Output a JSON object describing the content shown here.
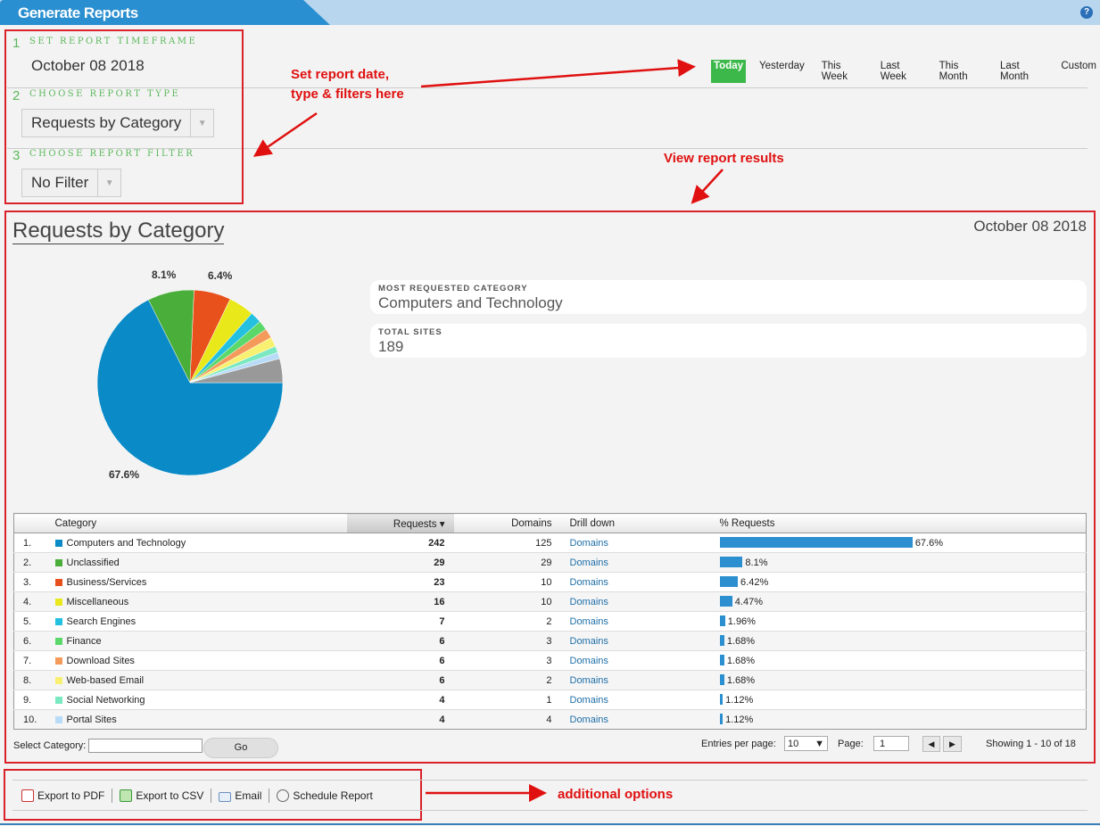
{
  "header": {
    "title": "Generate Reports",
    "help_icon": "help-icon"
  },
  "steps": [
    {
      "num": "1",
      "label": "SET REPORT TIMEFRAME",
      "value": "October 08 2018"
    },
    {
      "num": "2",
      "label": "CHOOSE REPORT TYPE",
      "value": "Requests by Category"
    },
    {
      "num": "3",
      "label": "CHOOSE REPORT FILTER",
      "value": "No Filter"
    }
  ],
  "periods": [
    "Today",
    "Yesterday",
    "This Week",
    "Last Week",
    "This Month",
    "Last Month",
    "Custom"
  ],
  "active_period": "Today",
  "annotations": {
    "set": "Set report date,",
    "set2": "type & filters here",
    "view": "View report results",
    "options": "additional options"
  },
  "report": {
    "title": "Requests by Category",
    "date": "October 08 2018",
    "most_label": "MOST REQUESTED CATEGORY",
    "most_value": "Computers and Technology",
    "total_label": "TOTAL SITES",
    "total_value": "189"
  },
  "chart_data": {
    "type": "pie",
    "slices": [
      {
        "name": "Computers and Technology",
        "value": 67.6,
        "color": "#0a8ac6"
      },
      {
        "name": "Unclassified",
        "value": 8.1,
        "color": "#4aae3a"
      },
      {
        "name": "Business/Services",
        "value": 6.42,
        "color": "#e8501c"
      },
      {
        "name": "Miscellaneous",
        "value": 4.47,
        "color": "#e8e81a"
      },
      {
        "name": "Search Engines",
        "value": 1.96,
        "color": "#24c0e0"
      },
      {
        "name": "Finance",
        "value": 1.68,
        "color": "#5ad86a"
      },
      {
        "name": "Download Sites",
        "value": 1.68,
        "color": "#f49a5a"
      },
      {
        "name": "Web-based Email",
        "value": 1.68,
        "color": "#f8f070"
      },
      {
        "name": "Social Networking",
        "value": 1.12,
        "color": "#7ae8c0"
      },
      {
        "name": "Portal Sites",
        "value": 1.12,
        "color": "#b8dcf8"
      },
      {
        "name": "",
        "value": 4.17,
        "color": "#999999"
      }
    ],
    "labels": [
      "67.6%",
      "8.1%",
      "6.4%"
    ]
  },
  "table": {
    "headers": [
      "",
      "Category",
      "Requests",
      "Domains",
      "Drill down",
      "% Requests"
    ],
    "rows": [
      {
        "n": "1.",
        "cat": "Computers and Technology",
        "req": "242",
        "dom": "125",
        "link": "Domains",
        "pct": 67.6,
        "pct_label": "67.6%",
        "color": "#0a8ac6"
      },
      {
        "n": "2.",
        "cat": "Unclassified",
        "req": "29",
        "dom": "29",
        "link": "Domains",
        "pct": 8.1,
        "pct_label": "8.1%",
        "color": "#4aae3a"
      },
      {
        "n": "3.",
        "cat": "Business/Services",
        "req": "23",
        "dom": "10",
        "link": "Domains",
        "pct": 6.42,
        "pct_label": "6.42%",
        "color": "#e8501c"
      },
      {
        "n": "4.",
        "cat": "Miscellaneous",
        "req": "16",
        "dom": "10",
        "link": "Domains",
        "pct": 4.47,
        "pct_label": "4.47%",
        "color": "#e8e81a"
      },
      {
        "n": "5.",
        "cat": "Search Engines",
        "req": "7",
        "dom": "2",
        "link": "Domains",
        "pct": 1.96,
        "pct_label": "1.96%",
        "color": "#24c0e0"
      },
      {
        "n": "6.",
        "cat": "Finance",
        "req": "6",
        "dom": "3",
        "link": "Domains",
        "pct": 1.68,
        "pct_label": "1.68%",
        "color": "#5ad86a"
      },
      {
        "n": "7.",
        "cat": "Download Sites",
        "req": "6",
        "dom": "3",
        "link": "Domains",
        "pct": 1.68,
        "pct_label": "1.68%",
        "color": "#f49a5a"
      },
      {
        "n": "8.",
        "cat": "Web-based Email",
        "req": "6",
        "dom": "2",
        "link": "Domains",
        "pct": 1.68,
        "pct_label": "1.68%",
        "color": "#f8f070"
      },
      {
        "n": "9.",
        "cat": "Social Networking",
        "req": "4",
        "dom": "1",
        "link": "Domains",
        "pct": 1.12,
        "pct_label": "1.12%",
        "color": "#7ae8c0"
      },
      {
        "n": "10.",
        "cat": "Portal Sites",
        "req": "4",
        "dom": "4",
        "link": "Domains",
        "pct": 1.12,
        "pct_label": "1.12%",
        "color": "#b8dcf8"
      }
    ]
  },
  "footer": {
    "select_label": "Select Category:",
    "go": "Go",
    "entries_label": "Entries per page:",
    "entries": "10",
    "page_label": "Page:",
    "page": "1",
    "showing": "Showing 1 - 10 of 18"
  },
  "options": [
    "Export to PDF",
    "Export to CSV",
    "Email",
    "Schedule Report"
  ]
}
